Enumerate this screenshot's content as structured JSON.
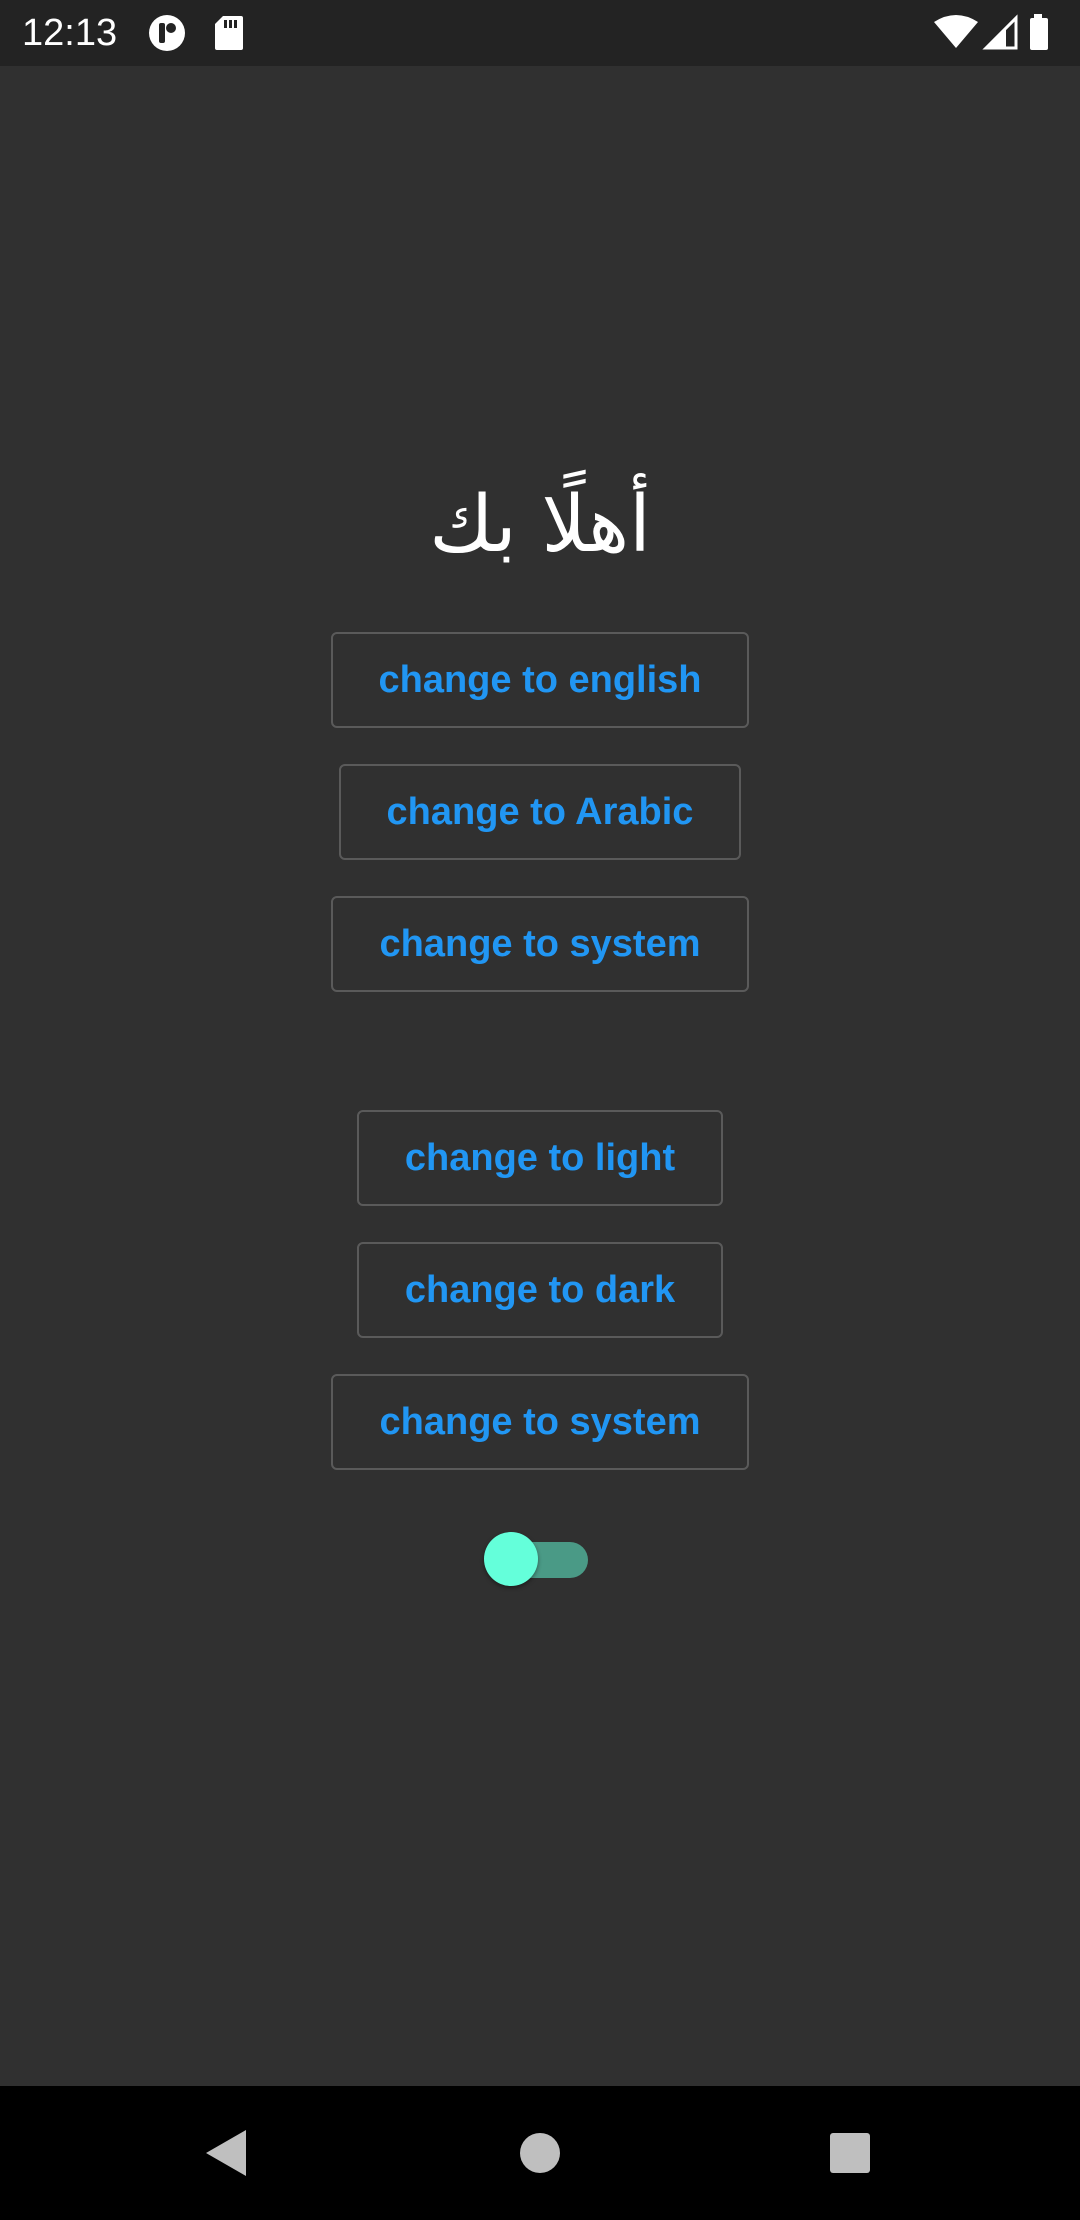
{
  "status_bar": {
    "time": "12:13",
    "left_icons": [
      "app-notification-icon",
      "sd-card-icon"
    ],
    "right_icons": [
      "wifi-icon",
      "cell-signal-icon",
      "battery-icon"
    ]
  },
  "main": {
    "greeting": "أهلًا بك",
    "language_buttons": [
      {
        "label": "change to english"
      },
      {
        "label": "change to Arabic"
      },
      {
        "label": "change to system"
      }
    ],
    "theme_buttons": [
      {
        "label": "change to light"
      },
      {
        "label": "change to dark"
      },
      {
        "label": "change to system"
      }
    ],
    "toggle": {
      "state": "off"
    }
  },
  "nav_bar": {
    "buttons": [
      "back-icon",
      "home-icon",
      "recents-icon"
    ]
  },
  "colors": {
    "background": "#303030",
    "status_bar": "#232323",
    "button_text": "#2196f3",
    "button_border": "#5a5a5a",
    "toggle_thumb": "#64ffda",
    "toggle_track": "#4a9a86",
    "nav_bar": "#000000"
  }
}
